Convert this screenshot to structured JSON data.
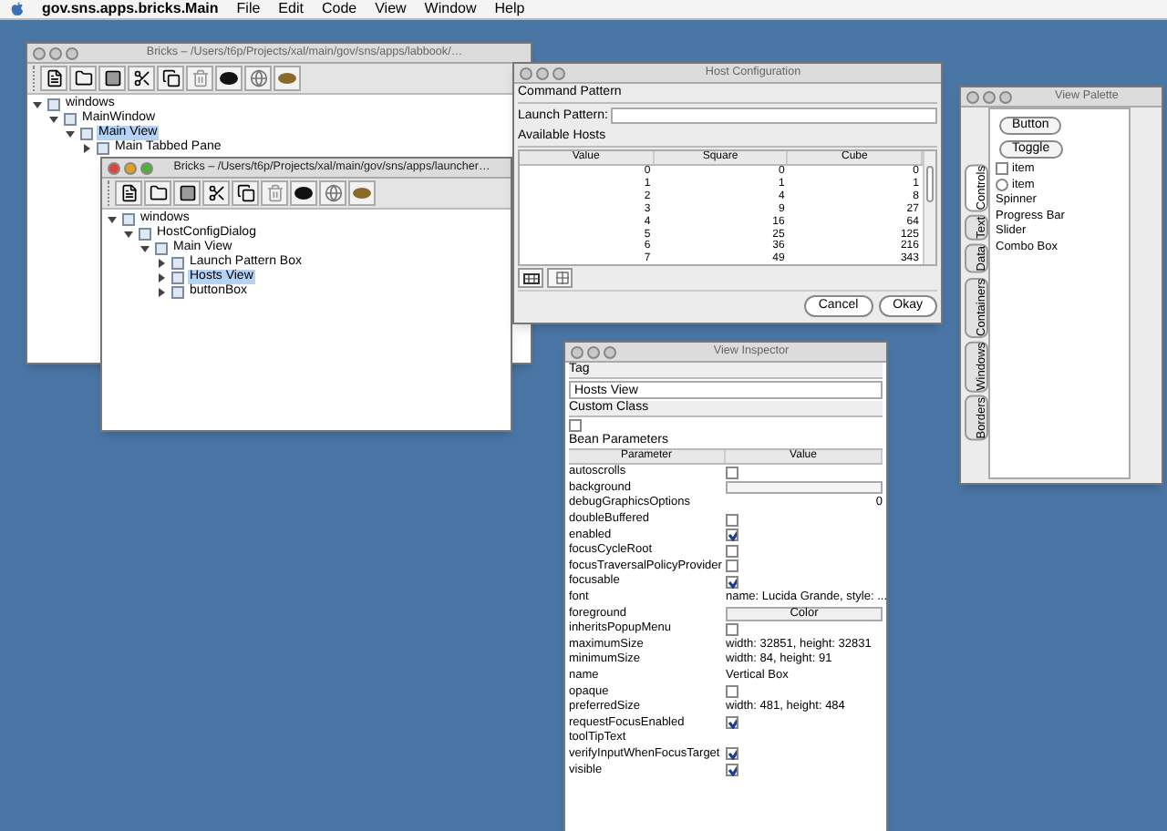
{
  "menubar": {
    "app_name": "gov.sns.apps.bricks.Main",
    "menus": [
      "File",
      "Edit",
      "Code",
      "View",
      "Window",
      "Help"
    ]
  },
  "bricks_windows": [
    {
      "title": "Bricks – /Users/t6p/Projects/xal/main/gov/sns/apps/labbook/…",
      "active": false,
      "tree": [
        {
          "label": "windows",
          "expanded": true,
          "selected": false,
          "children": [
            {
              "label": "MainWindow",
              "expanded": true,
              "selected": false,
              "children": [
                {
                  "label": "Main View",
                  "expanded": true,
                  "selected": true,
                  "children": [
                    {
                      "label": "Main Tabbed Pane",
                      "expanded": false,
                      "selected": false
                    }
                  ]
                }
              ]
            }
          ]
        }
      ]
    },
    {
      "title": "Bricks – /Users/t6p/Projects/xal/main/gov/sns/apps/launcher…",
      "active": true,
      "tree": [
        {
          "label": "windows",
          "expanded": true,
          "selected": false,
          "children": [
            {
              "label": "HostConfigDialog",
              "expanded": true,
              "selected": false,
              "children": [
                {
                  "label": "Main View",
                  "expanded": true,
                  "selected": false,
                  "children": [
                    {
                      "label": "Launch Pattern Box",
                      "expanded": false,
                      "selected": false
                    },
                    {
                      "label": "Hosts View",
                      "expanded": false,
                      "selected": true
                    },
                    {
                      "label": "buttonBox",
                      "expanded": false,
                      "selected": false
                    }
                  ]
                }
              ]
            }
          ]
        }
      ]
    }
  ],
  "host_configuration": {
    "title": "Host Configuration",
    "command_pattern_heading": "Command Pattern",
    "launch_pattern_label": "Launch Pattern:",
    "available_hosts_heading": "Available Hosts",
    "columns": [
      "Value",
      "Square",
      "Cube"
    ],
    "rows": [
      [
        "0",
        "0",
        "0"
      ],
      [
        "1",
        "1",
        "1"
      ],
      [
        "2",
        "4",
        "8"
      ],
      [
        "3",
        "9",
        "27"
      ],
      [
        "4",
        "16",
        "64"
      ],
      [
        "5",
        "25",
        "125"
      ],
      [
        "6",
        "36",
        "216"
      ],
      [
        "7",
        "49",
        "343"
      ]
    ],
    "buttons": [
      "Cancel",
      "Okay"
    ]
  },
  "view_inspector": {
    "title": "View Inspector",
    "tag_heading": "Tag",
    "tag_value": "Hosts View",
    "custom_class_heading": "Custom Class",
    "custom_class_checked": false,
    "bean_heading": "Bean Parameters",
    "columns": [
      "Parameter",
      "Value"
    ],
    "rows": [
      {
        "name": "autoscrolls",
        "kind": "checkbox",
        "checked": false
      },
      {
        "name": "background",
        "kind": "color_field"
      },
      {
        "name": "debugGraphicsOptions",
        "kind": "number",
        "value": "0"
      },
      {
        "name": "doubleBuffered",
        "kind": "checkbox",
        "checked": false
      },
      {
        "name": "enabled",
        "kind": "checkbox",
        "checked": true
      },
      {
        "name": "focusCycleRoot",
        "kind": "checkbox",
        "checked": false
      },
      {
        "name": "focusTraversalPolicyProvider",
        "kind": "checkbox",
        "checked": false
      },
      {
        "name": "focusable",
        "kind": "checkbox",
        "checked": true
      },
      {
        "name": "font",
        "kind": "text",
        "value": "name:  Lucida Grande, style: ..."
      },
      {
        "name": "foreground",
        "kind": "button",
        "value": "Color"
      },
      {
        "name": "inheritsPopupMenu",
        "kind": "checkbox",
        "checked": false
      },
      {
        "name": "maximumSize",
        "kind": "text",
        "value": "width:  32851, height:  32831"
      },
      {
        "name": "minimumSize",
        "kind": "text",
        "value": "width:  84, height:  91"
      },
      {
        "name": "name",
        "kind": "text",
        "value": "Vertical Box"
      },
      {
        "name": "opaque",
        "kind": "checkbox",
        "checked": false
      },
      {
        "name": "preferredSize",
        "kind": "text",
        "value": "width:  481, height:  484"
      },
      {
        "name": "requestFocusEnabled",
        "kind": "checkbox",
        "checked": true
      },
      {
        "name": "toolTipText",
        "kind": "text"
      },
      {
        "name": "verifyInputWhenFocusTarget",
        "kind": "checkbox",
        "checked": true
      },
      {
        "name": "visible",
        "kind": "checkbox",
        "checked": true
      }
    ]
  },
  "view_palette": {
    "title": "View Palette",
    "tabs": [
      {
        "label": "Controls",
        "selected": true
      },
      {
        "label": "Text",
        "selected": false
      },
      {
        "label": "Data",
        "selected": false
      },
      {
        "label": "Containers",
        "selected": false
      },
      {
        "label": "Windows",
        "selected": false
      },
      {
        "label": "Borders",
        "selected": false
      }
    ],
    "items": [
      {
        "kind": "button",
        "label": "Button"
      },
      {
        "kind": "button",
        "label": "Toggle"
      },
      {
        "kind": "checkbox",
        "label": "item",
        "checked": false
      },
      {
        "kind": "radio",
        "label": "item",
        "selected": false
      },
      {
        "kind": "label",
        "label": "Spinner"
      },
      {
        "kind": "label",
        "label": "Progress Bar"
      },
      {
        "kind": "label",
        "label": "Slider"
      },
      {
        "kind": "label",
        "label": "Combo Box"
      }
    ]
  }
}
